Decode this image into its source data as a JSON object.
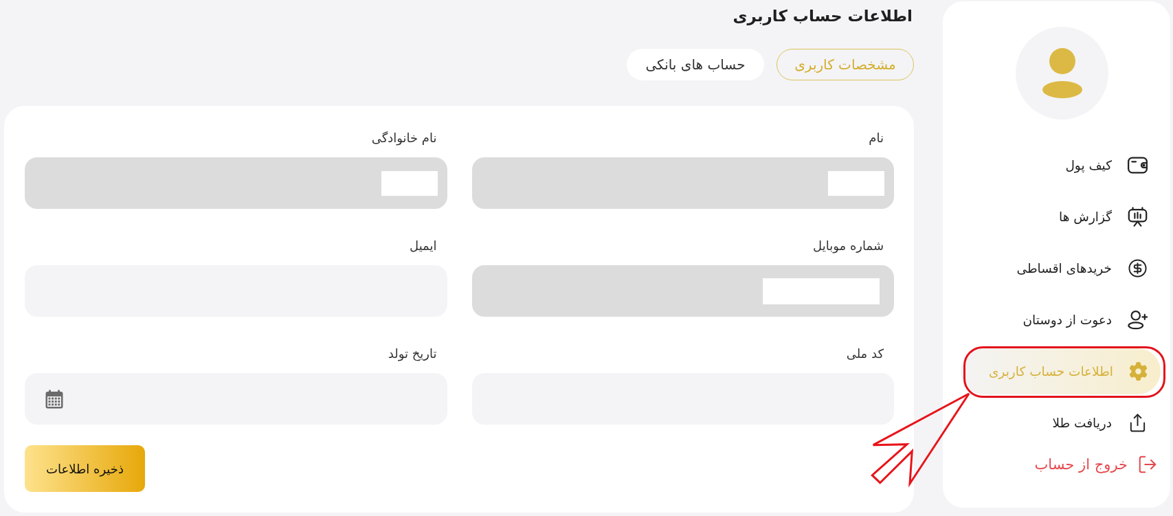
{
  "sidebar": {
    "menu": [
      {
        "label": "کیف پول",
        "kind": "link",
        "selected": false,
        "circled": false
      },
      {
        "label": "گزارش ها",
        "kind": "link",
        "selected": false,
        "circled": false
      },
      {
        "label": "خریدهای اقساطی",
        "kind": "link",
        "selected": false,
        "circled": false
      },
      {
        "label": "دعوت از دوستان",
        "kind": "link",
        "selected": false,
        "circled": false
      },
      {
        "label": "اطلاعات حساب کاربری",
        "kind": "link",
        "selected": true,
        "circled": true
      },
      {
        "label": "دریافت طلا",
        "kind": "link",
        "selected": false,
        "circled": false
      },
      {
        "label": "خروج از حساب",
        "kind": "logout",
        "selected": false,
        "circled": false
      }
    ]
  },
  "page_title": "اطلاعات حساب کاربری",
  "tabs": [
    {
      "label": "مشخصات کاربری",
      "selected": true
    },
    {
      "label": "حساب های بانکی",
      "selected": false
    }
  ],
  "form": {
    "fields": [
      {
        "label": "نام",
        "kind": "text",
        "disabled": true,
        "redacted": true
      },
      {
        "label": "نام خانوادگی",
        "kind": "text",
        "disabled": true,
        "redacted": true
      },
      {
        "label": "شماره موبایل",
        "kind": "phone",
        "disabled": true,
        "redacted": true
      },
      {
        "label": "ایمیل",
        "kind": "text",
        "disabled": false,
        "redacted": false
      },
      {
        "label": "کد ملی",
        "kind": "text",
        "disabled": false,
        "redacted": false
      },
      {
        "label": "تاریخ تولد",
        "kind": "date",
        "disabled": false,
        "redacted": false
      }
    ],
    "submit": "ذخیره اطلاعات"
  },
  "annotation": {
    "kind": "outline-arrow"
  }
}
